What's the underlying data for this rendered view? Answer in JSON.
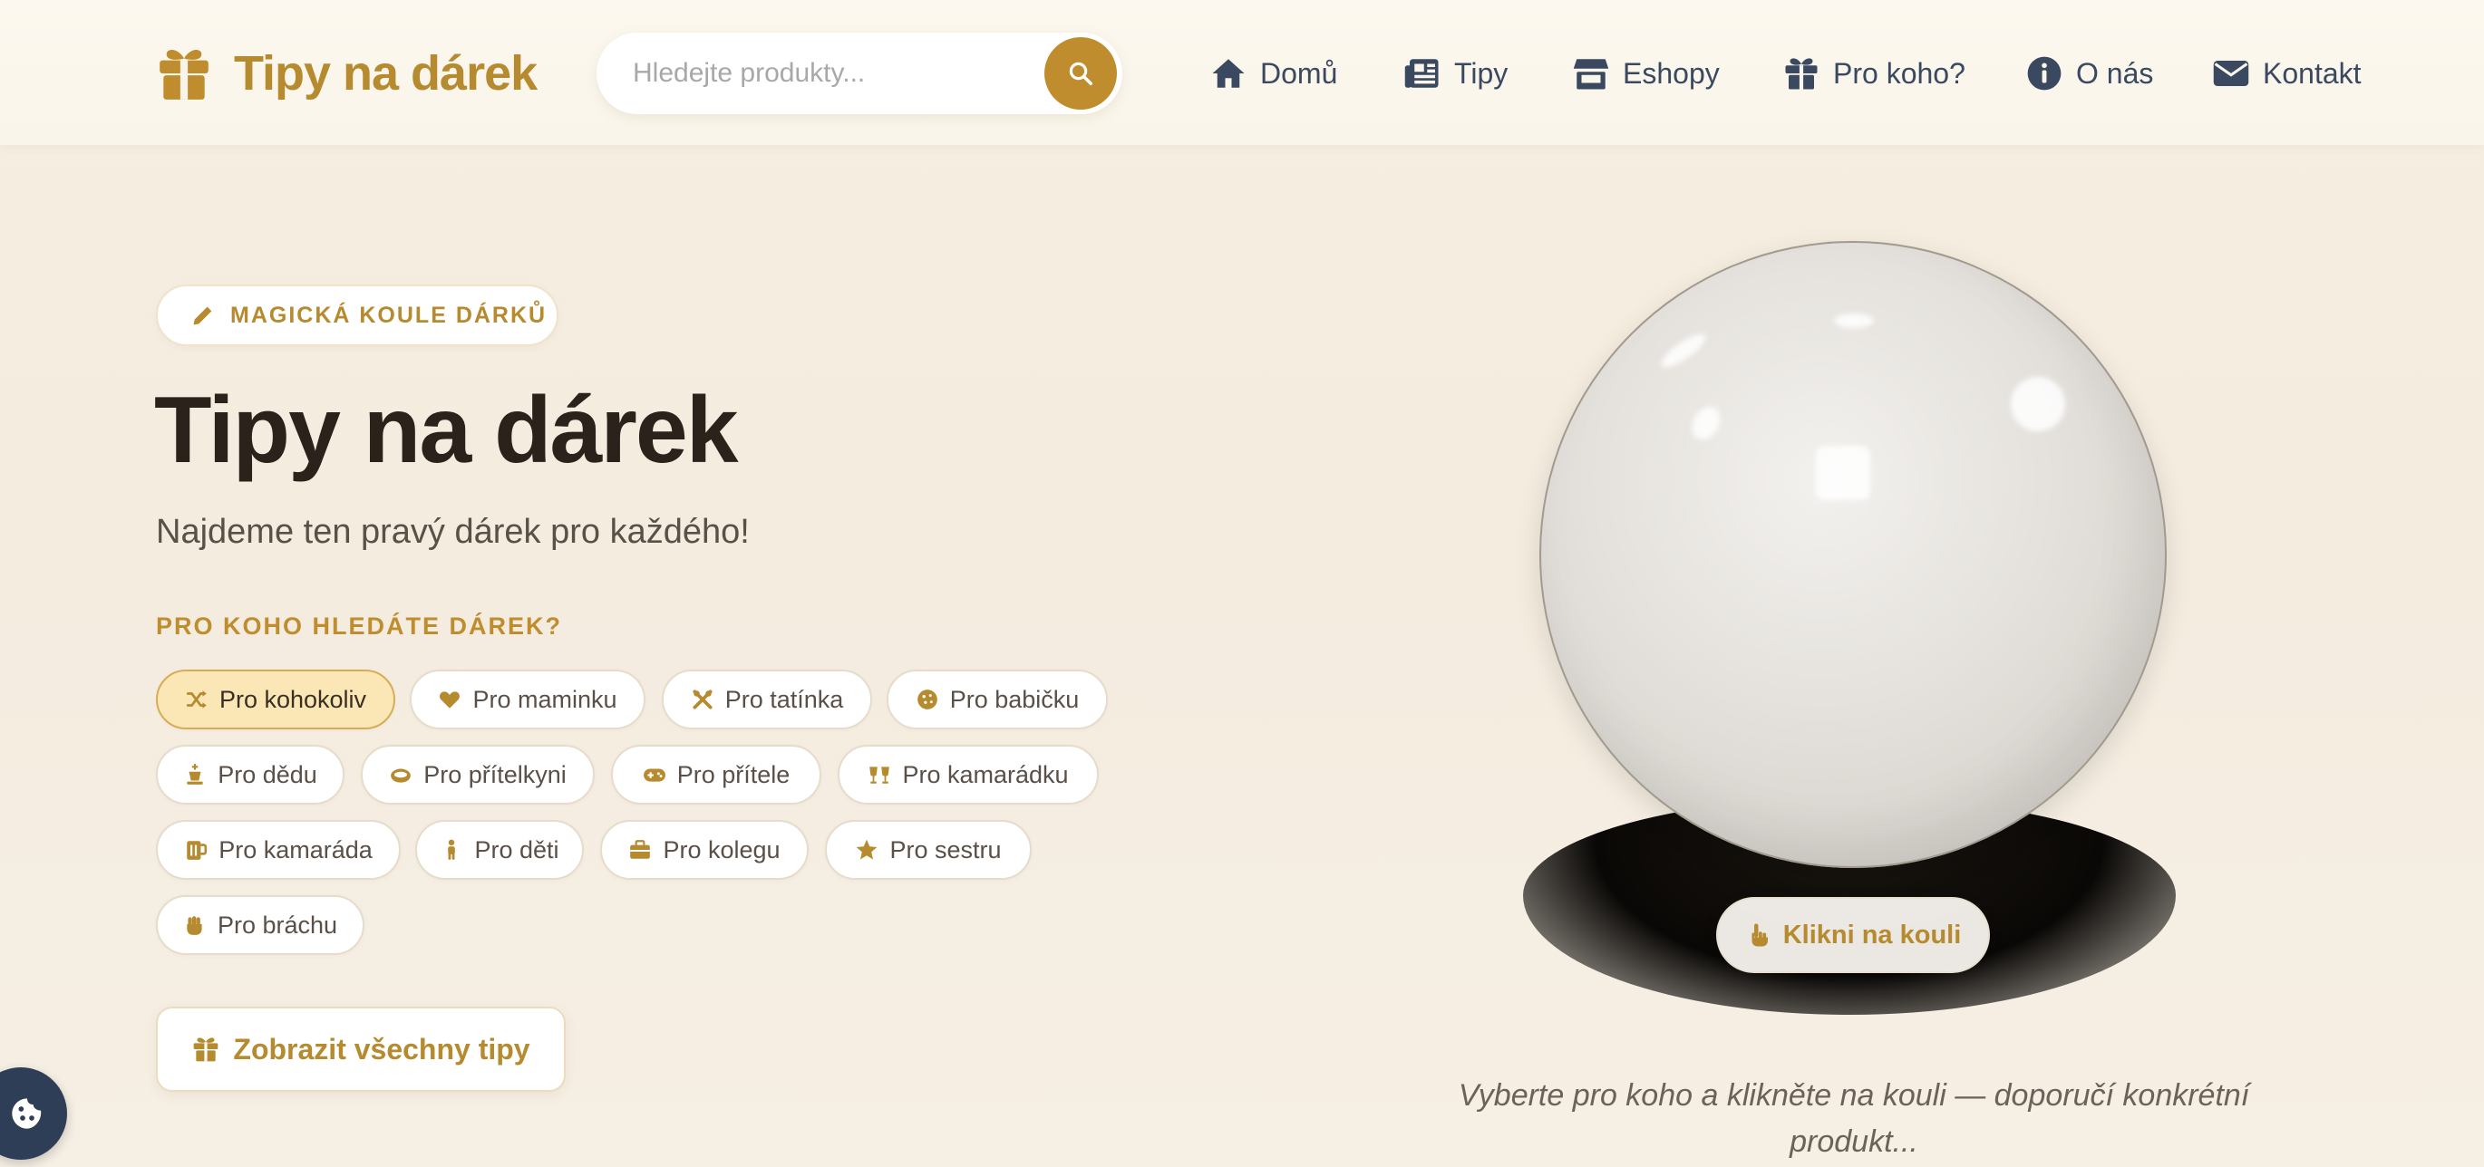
{
  "brand": {
    "name": "Tipy na dárek",
    "icon": "gift-icon"
  },
  "search": {
    "placeholder": "Hledejte produkty...",
    "value": ""
  },
  "nav": [
    {
      "label": "Domů",
      "icon": "home-icon"
    },
    {
      "label": "Tipy",
      "icon": "newspaper-icon"
    },
    {
      "label": "Eshopy",
      "icon": "store-icon"
    },
    {
      "label": "Pro koho?",
      "icon": "gift-icon"
    },
    {
      "label": "O nás",
      "icon": "info-icon"
    },
    {
      "label": "Kontakt",
      "icon": "envelope-icon"
    }
  ],
  "hero": {
    "badge": "MAGICKÁ KOULE DÁRKŮ",
    "title": "Tipy na dárek",
    "subtitle": "Najdeme ten pravý dárek pro každého!",
    "section_label": "PRO KOHO HLEDÁTE DÁREK?",
    "cta": "Zobrazit všechny tipy"
  },
  "recipients": [
    {
      "label": "Pro kohokoliv",
      "icon": "shuffle-icon",
      "active": true
    },
    {
      "label": "Pro maminku",
      "icon": "heart-icon",
      "active": false
    },
    {
      "label": "Pro tatínka",
      "icon": "tools-icon",
      "active": false
    },
    {
      "label": "Pro babičku",
      "icon": "cookie-icon",
      "active": false
    },
    {
      "label": "Pro dědu",
      "icon": "chess-king-icon",
      "active": false
    },
    {
      "label": "Pro přítelkyni",
      "icon": "ring-icon",
      "active": false
    },
    {
      "label": "Pro přítele",
      "icon": "gamepad-icon",
      "active": false
    },
    {
      "label": "Pro kamarádku",
      "icon": "glass-cheers-icon",
      "active": false
    },
    {
      "label": "Pro kamaráda",
      "icon": "beer-mug-icon",
      "active": false
    },
    {
      "label": "Pro děti",
      "icon": "child-icon",
      "active": false
    },
    {
      "label": "Pro kolegu",
      "icon": "briefcase-icon",
      "active": false
    },
    {
      "label": "Pro sestru",
      "icon": "star-icon",
      "active": false
    },
    {
      "label": "Pro bráchu",
      "icon": "fist-icon",
      "active": false
    }
  ],
  "ball": {
    "button": "Klikni na kouli",
    "hint": "Vyberte pro koho a klikněte na kouli — doporučí konkrétní produkt..."
  },
  "colors": {
    "accent": "#c08d2e",
    "brand": "#b68a2e",
    "nav_text": "#3a4860",
    "heading": "#2a221b",
    "cookie_button": "#2f3e57"
  },
  "cookie": {
    "icon": "cookie-icon"
  }
}
